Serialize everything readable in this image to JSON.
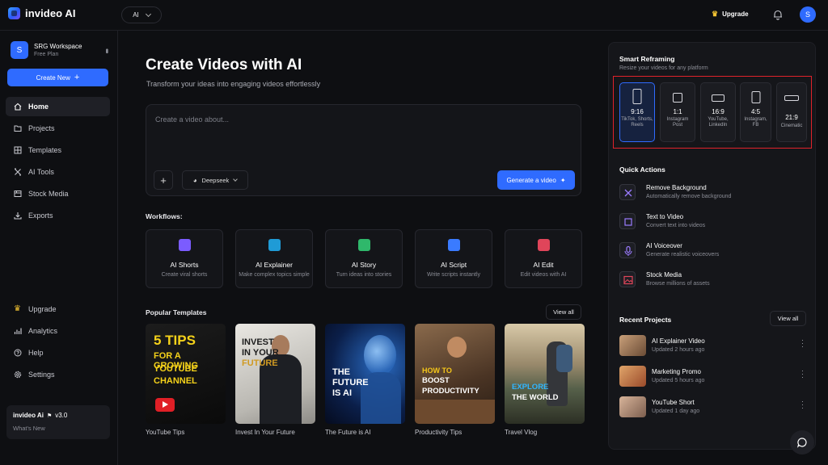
{
  "topbar": {
    "logo_text": "invideo AI",
    "model_selector": "AI",
    "upgrade_label": "Upgrade",
    "avatar_initial": "S"
  },
  "sidebar": {
    "workspace": {
      "initial": "S",
      "name": "SRG Workspace",
      "plan": "Free Plan"
    },
    "create_new_label": "Create New",
    "items": [
      {
        "label": "Home",
        "icon": "home-icon",
        "active": true
      },
      {
        "label": "Projects",
        "icon": "folder-icon"
      },
      {
        "label": "Templates",
        "icon": "grid-icon"
      },
      {
        "label": "AI Tools",
        "icon": "tools-icon"
      },
      {
        "label": "Stock Media",
        "icon": "media-icon"
      },
      {
        "label": "Exports",
        "icon": "download-icon"
      }
    ],
    "bottom_items": [
      {
        "label": "Upgrade",
        "icon": "crown-icon"
      },
      {
        "label": "Analytics",
        "icon": "bar-chart-icon"
      },
      {
        "label": "Help",
        "icon": "help-icon"
      },
      {
        "label": "Settings",
        "icon": "gear-icon"
      }
    ],
    "version": {
      "brand": "invideo Ai",
      "version": "v3.0",
      "subtitle": "What's New"
    }
  },
  "main": {
    "title": "Create Videos with AI",
    "subtitle": "Transform your ideas into engaging videos effortlessly",
    "prompt_placeholder": "Create a video about...",
    "model_label": "Deepseek",
    "generate_label": "Generate a video",
    "workflows_label": "Workflows:",
    "workflows": [
      {
        "title": "AI Shorts",
        "subtitle": "Create viral shorts",
        "color": "#7b5cff"
      },
      {
        "title": "AI Explainer",
        "subtitle": "Make complex topics simple",
        "color": "#1f9bd6"
      },
      {
        "title": "AI Story",
        "subtitle": "Turn ideas into stories",
        "color": "#2fb86b"
      },
      {
        "title": "AI Script",
        "subtitle": "Write scripts instantly",
        "color": "#3a7bff"
      },
      {
        "title": "AI Edit",
        "subtitle": "Edit videos with AI",
        "color": "#e0455a"
      }
    ],
    "templates_label": "Popular Templates",
    "view_all_label": "View all",
    "templates": [
      {
        "label": "YouTube Tips",
        "overlay": [
          "5 TIPS",
          "FOR A GROWING",
          "YOUTUBE",
          "CHANNEL"
        ]
      },
      {
        "label": "Invest In Your Future",
        "overlay": [
          "INVEST",
          "IN YOUR",
          "FUTURE"
        ]
      },
      {
        "label": "The Future is AI",
        "overlay": [
          "THE",
          "FUTURE",
          "IS AI"
        ]
      },
      {
        "label": "Productivity Tips",
        "overlay": [
          "HOW TO",
          "BOOST",
          "PRODUCTIVITY"
        ]
      },
      {
        "label": "Travel Vlog",
        "overlay": [
          "EXPLORE",
          "THE WORLD"
        ]
      }
    ]
  },
  "right_panel": {
    "smart_reframing": {
      "title": "Smart Reframing",
      "subtitle": "Resize your videos for any platform",
      "ratios": [
        {
          "value": "9:16",
          "label": "TikTok, Shorts, Reels",
          "selected": true
        },
        {
          "value": "1:1",
          "label": "Instagram Post"
        },
        {
          "value": "16:9",
          "label": "YouTube, LinkedIn"
        },
        {
          "value": "4:5",
          "label": "Instagram, FB"
        },
        {
          "value": "21:9",
          "label": "Cinematic"
        }
      ]
    },
    "quick_actions": {
      "title": "Quick Actions",
      "items": [
        {
          "title": "Remove Background",
          "subtitle": "Automatically remove background",
          "icon": "remove-bg-icon"
        },
        {
          "title": "Text to Video",
          "subtitle": "Convert text into videos",
          "icon": "text-to-video-icon"
        },
        {
          "title": "AI Voiceover",
          "subtitle": "Generate realistic voiceovers",
          "icon": "microphone-icon"
        },
        {
          "title": "Stock Media",
          "subtitle": "Browse millions of assets",
          "icon": "image-icon"
        }
      ]
    },
    "recent_projects": {
      "title": "Recent Projects",
      "view_all_label": "View all",
      "items": [
        {
          "title": "AI Explainer Video",
          "subtitle": "Updated 2 hours ago"
        },
        {
          "title": "Marketing Promo",
          "subtitle": "Updated 5 hours ago"
        },
        {
          "title": "YouTube Short",
          "subtitle": "Updated 1 day ago"
        }
      ]
    }
  }
}
